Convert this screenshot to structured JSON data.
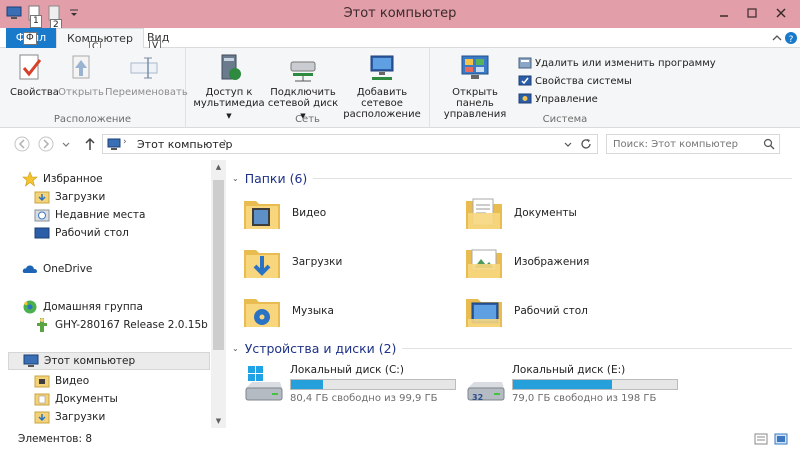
{
  "window": {
    "title": "Этот компьютер",
    "controls": [
      "minimize-icon",
      "maximize-icon",
      "close-icon"
    ]
  },
  "quick_access": {
    "keytips": [
      "1",
      "2"
    ]
  },
  "tabs": {
    "file": "Файл",
    "file_keytip": "Ф",
    "computer": "Компьютер",
    "computer_keytip": "C",
    "view": "Вид",
    "view_keytip": "V"
  },
  "ribbon": {
    "groups": {
      "location": "Расположение",
      "network": "Сеть",
      "system": "Система"
    },
    "location": {
      "properties": "Свойства",
      "open": "Открыть",
      "rename": "Переименовать"
    },
    "network": {
      "media_line1": "Доступ к",
      "media_line2": "мультимедиа",
      "map_line1": "Подключить",
      "map_line2": "сетевой диск",
      "add_line1": "Добавить сетевое",
      "add_line2": "расположение"
    },
    "system": {
      "control_line1": "Открыть панель",
      "control_line2": "управления",
      "uninstall": "Удалить или изменить программу",
      "sys_props": "Свойства системы",
      "manage": "Управление"
    }
  },
  "nav": {
    "address": "Этот компьютер",
    "search_placeholder": "Поиск: Этот компьютер"
  },
  "navpane": {
    "favorites": "Избранное",
    "downloads": "Загрузки",
    "recent": "Недавние места",
    "desktop": "Рабочий стол",
    "onedrive": "OneDrive",
    "homegroup": "Домашняя группа",
    "hg_item": "GHY-280167 Release 2.0.15b",
    "thispc": "Этот компьютер",
    "video": "Видео",
    "documents": "Документы",
    "downloads2": "Загрузки"
  },
  "content": {
    "folders_header": "Папки (6)",
    "folders": [
      "Видео",
      "Документы",
      "Загрузки",
      "Изображения",
      "Музыка",
      "Рабочий стол"
    ],
    "drives_header": "Устройства и диски (2)",
    "drives": [
      {
        "name": "Локальный диск (C:)",
        "free": "80,4 ГБ свободно из 99,9 ГБ",
        "used_fraction": 0.195
      },
      {
        "name": "Локальный диск (E:)",
        "free": "79,0 ГБ свободно из 198 ГБ",
        "used_fraction": 0.601
      }
    ]
  },
  "status": {
    "count": "Элементов: 8"
  },
  "colors": {
    "titlebar": "#e39fa9",
    "file_tab": "#1979ca",
    "drive_bar": "#26a0da",
    "section_header": "#1e3287"
  }
}
